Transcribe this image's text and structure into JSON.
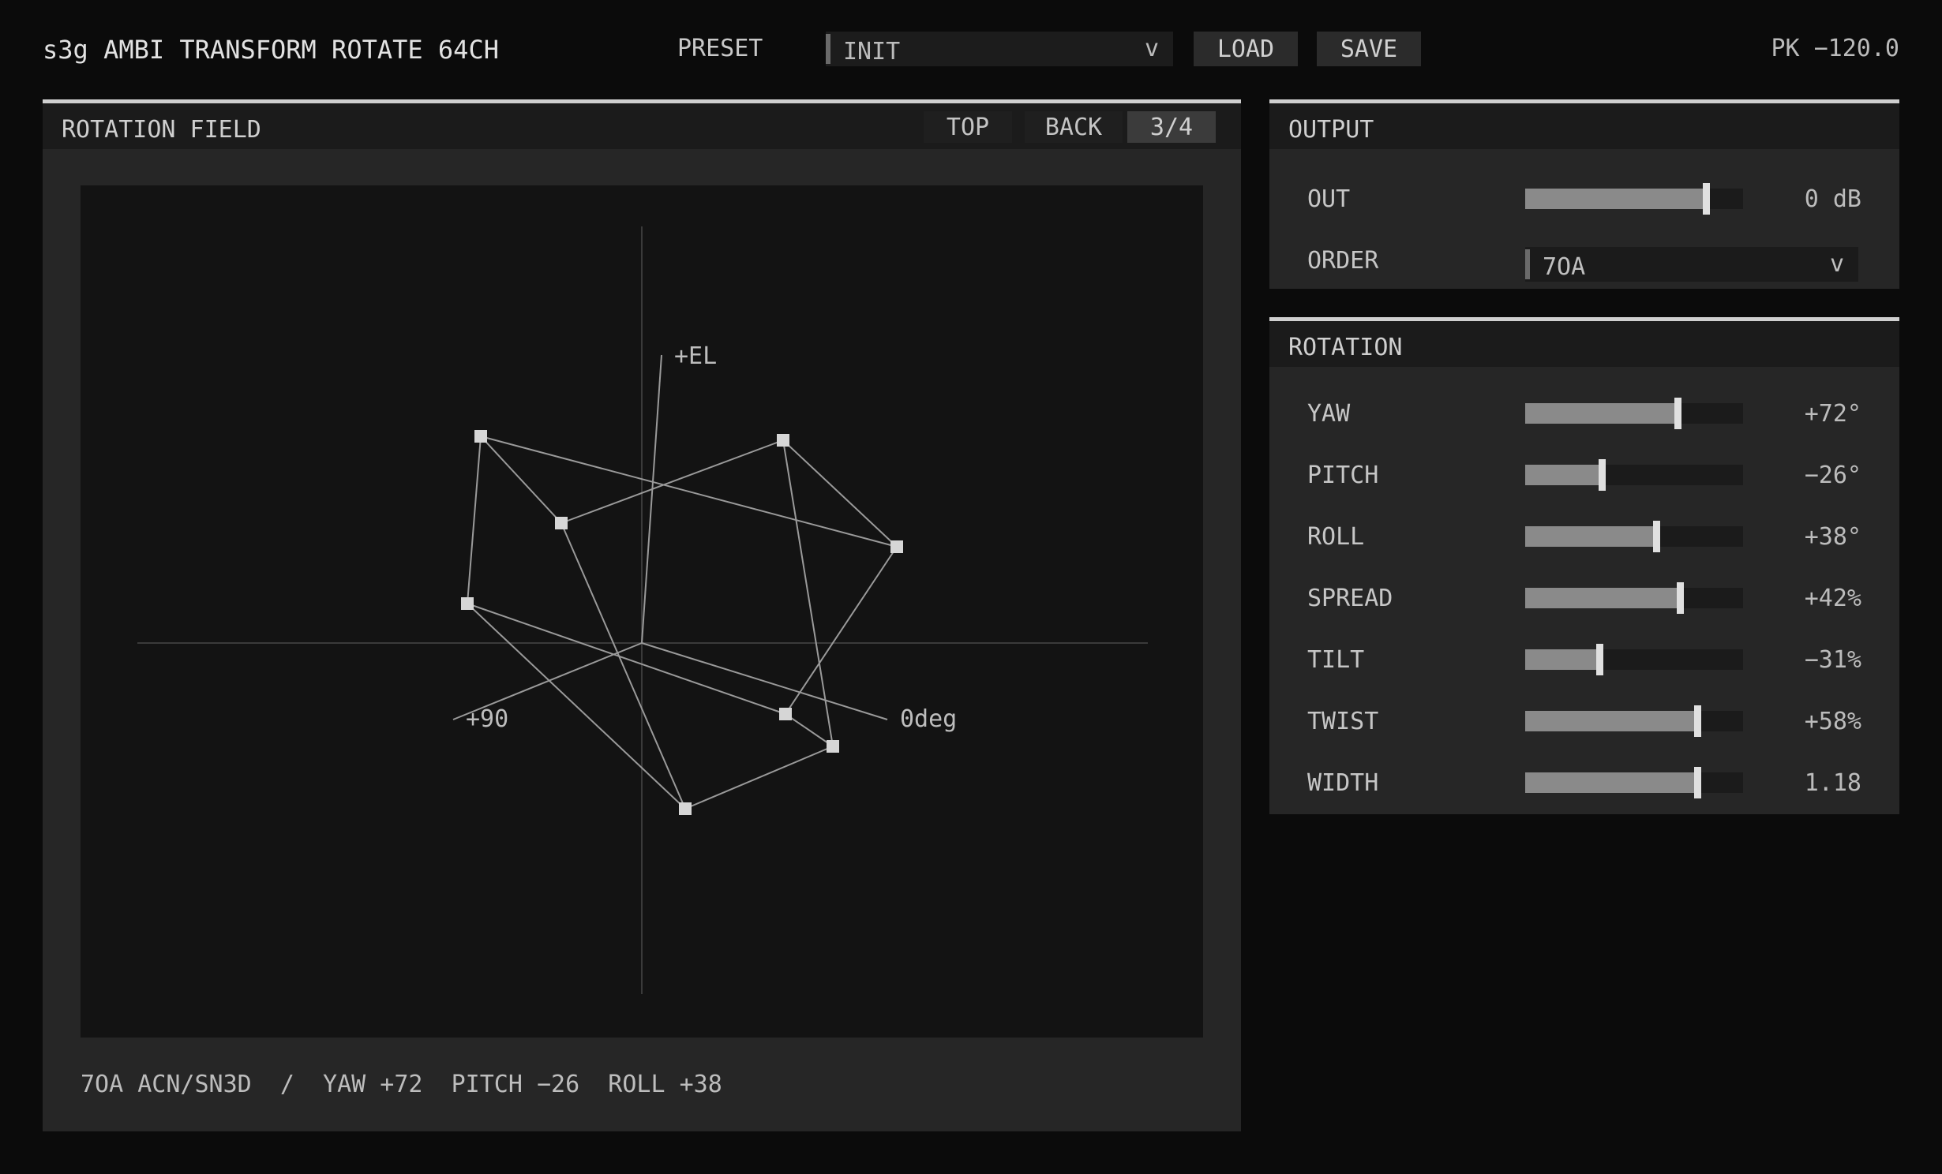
{
  "header": {
    "title": "s3g AMBI TRANSFORM ROTATE 64CH",
    "preset_label": "PRESET",
    "preset_value": "INIT",
    "preset_chevron": "v",
    "load_label": "LOAD",
    "save_label": "SAVE",
    "peak": "PK −120.0"
  },
  "field": {
    "title": "ROTATION FIELD",
    "views": [
      "TOP",
      "BACK",
      "3/4"
    ],
    "active_view": "3/4",
    "axis_labels": {
      "el": "+EL",
      "az90": "+90",
      "az0": "0deg"
    },
    "status": "7OA ACN/SN3D  /  YAW +72  PITCH −26  ROLL +38"
  },
  "output": {
    "title": "OUTPUT",
    "out_label": "OUT",
    "out_value": "0 dB",
    "out_level": 0.83,
    "order_label": "ORDER",
    "order_value": "7OA",
    "order_chevron": "v"
  },
  "rotation": {
    "title": "ROTATION",
    "params": [
      {
        "label": "YAW",
        "value": "+72°",
        "level": 0.7
      },
      {
        "label": "PITCH",
        "value": "−26°",
        "level": 0.35
      },
      {
        "label": "ROLL",
        "value": "+38°",
        "level": 0.6
      },
      {
        "label": "SPREAD",
        "value": "+42%",
        "level": 0.71
      },
      {
        "label": "TILT",
        "value": "−31%",
        "level": 0.34
      },
      {
        "label": "TWIST",
        "value": "+58%",
        "level": 0.79
      },
      {
        "label": "WIDTH",
        "value": "1.18",
        "level": 0.79
      }
    ]
  },
  "colors": {
    "background": "#0b0b0b",
    "panel": "#262626",
    "plot": "#131313",
    "accent": "#cfcfcf",
    "line": "#9a9a9a"
  }
}
